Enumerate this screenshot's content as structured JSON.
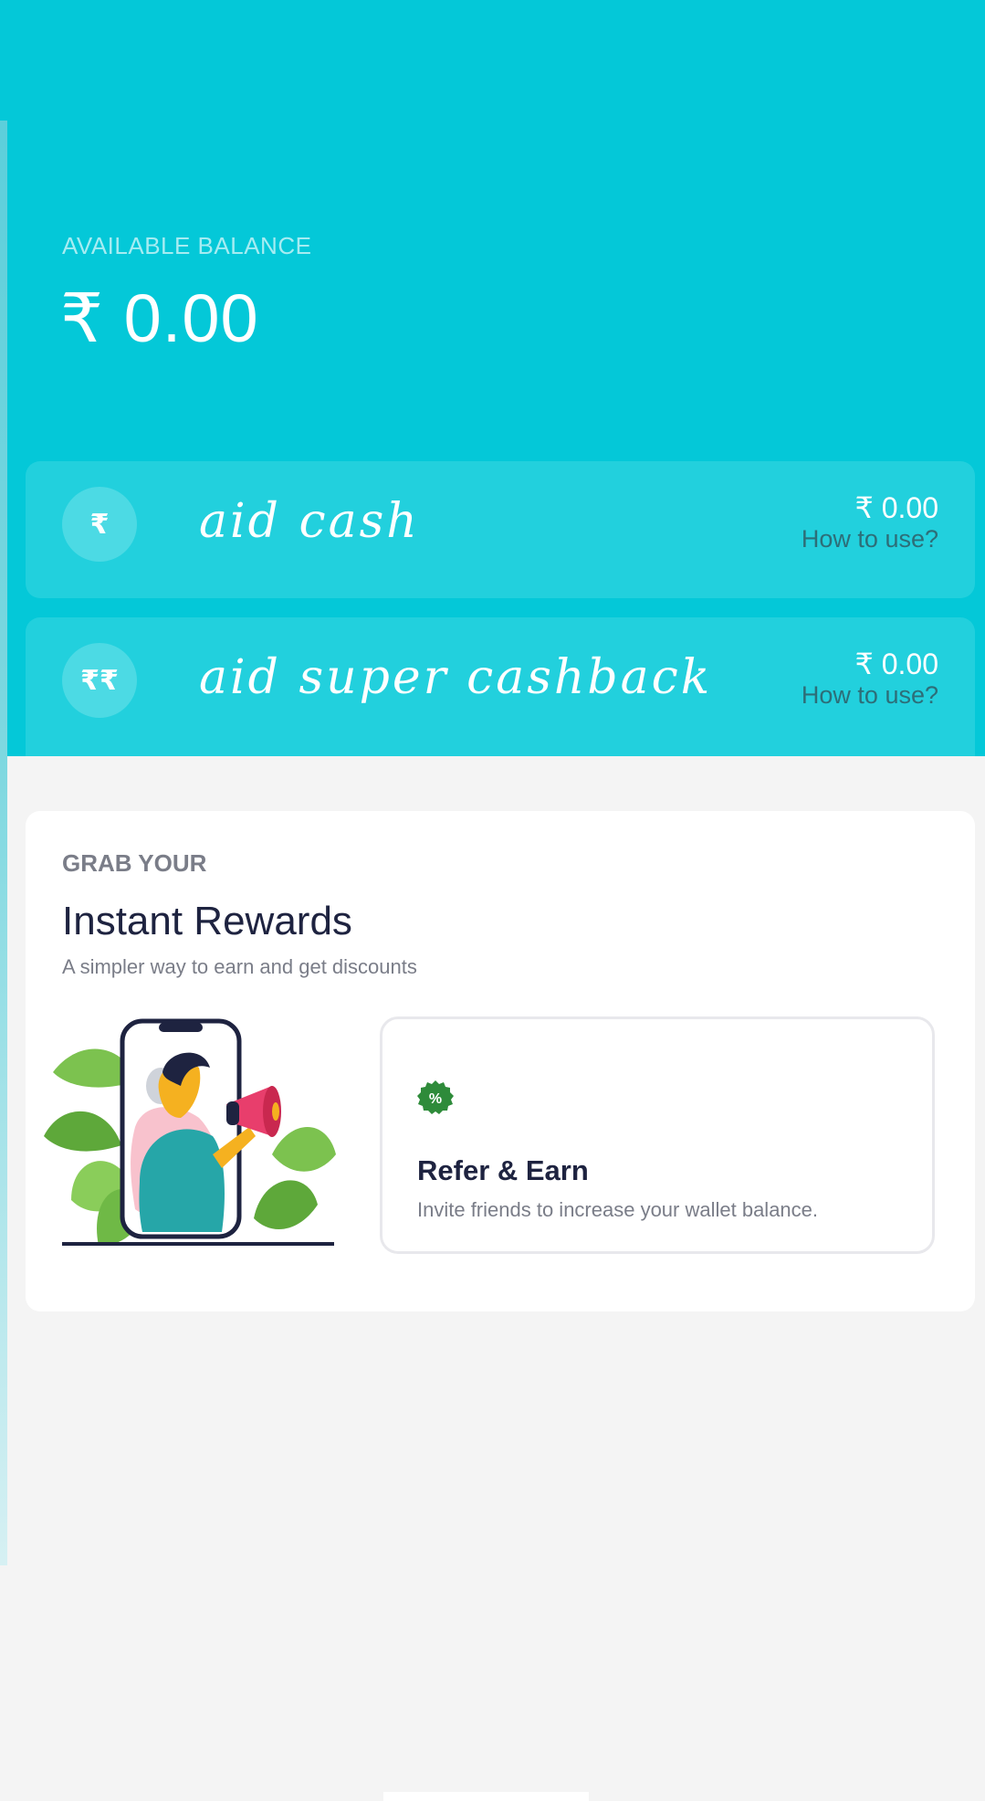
{
  "header": {
    "balance_label": "AVAILABLE BALANCE",
    "balance_value": "₹ 0.00"
  },
  "wallets": [
    {
      "icon_glyph": "₹",
      "name": "aid cash",
      "amount": "₹ 0.00",
      "help": "How to use?"
    },
    {
      "icon_glyph": "₹₹",
      "name": "aid super cashback",
      "amount": "₹ 0.00",
      "help": "How to use?"
    }
  ],
  "rewards": {
    "eyebrow": "GRAB YOUR",
    "title": "Instant Rewards",
    "subtitle": "A simpler way to earn and get discounts",
    "refer": {
      "badge_glyph": "%",
      "title": "Refer & Earn",
      "description": "Invite friends to increase your wallet balance."
    }
  },
  "colors": {
    "header_bg": "#04c8d8",
    "wallet_card_bg": "#22d0dd",
    "page_bg": "#f4f4f4",
    "badge_green": "#2e8b3a",
    "title_dark": "#1e2340"
  }
}
